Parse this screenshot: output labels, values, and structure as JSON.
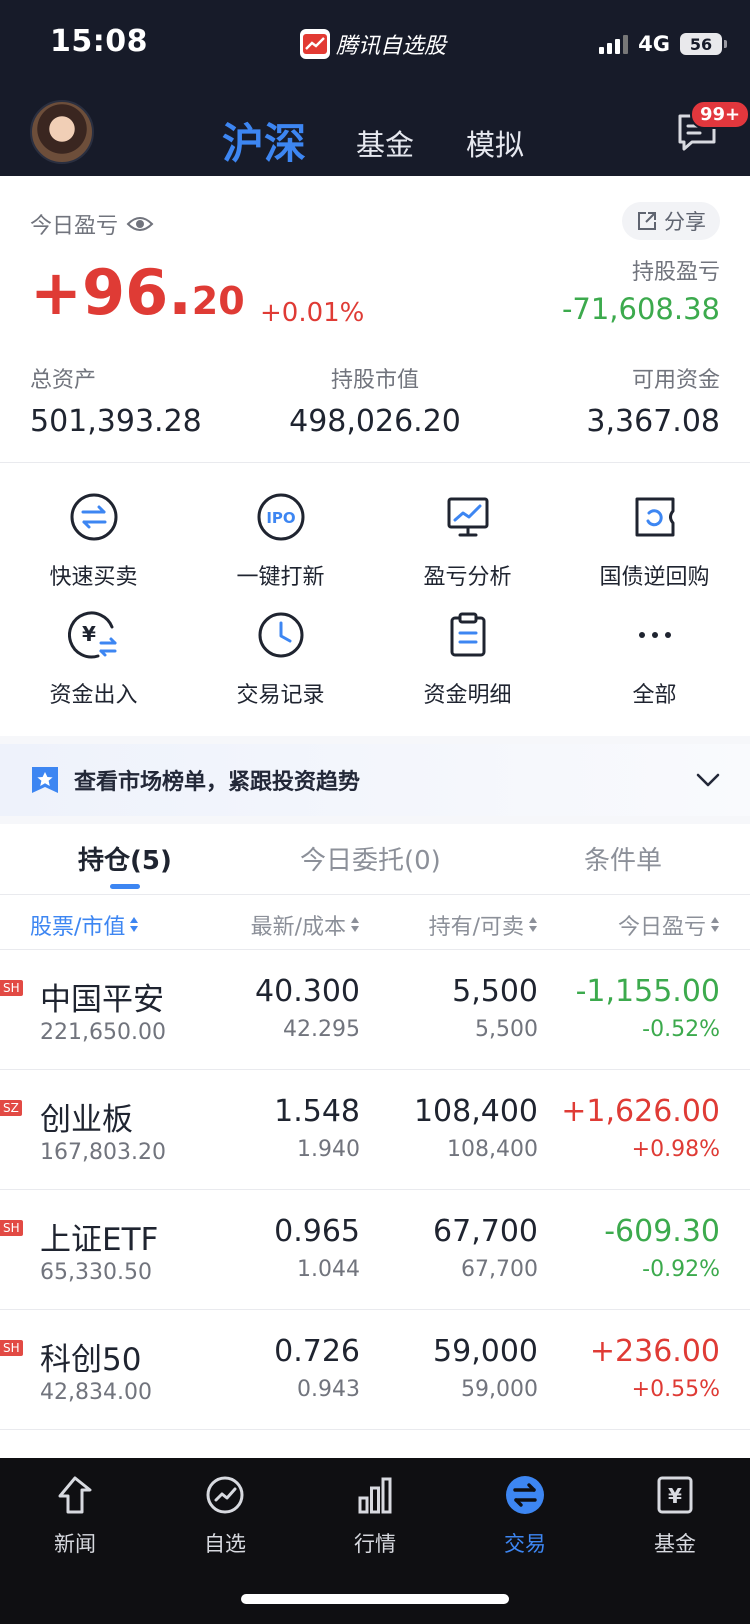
{
  "status_bar": {
    "time": "15:08",
    "app_name": "腾讯自选股",
    "network": "4G",
    "battery": "56"
  },
  "header": {
    "tabs": [
      {
        "label": "沪深",
        "active": true
      },
      {
        "label": "基金",
        "active": false
      },
      {
        "label": "模拟",
        "active": false
      }
    ],
    "message_badge": "99+"
  },
  "summary": {
    "today_pnl_label": "今日盈亏",
    "share_label": "分享",
    "today_pnl_int": "+96.",
    "today_pnl_dec": "20",
    "today_pnl_pct": "+0.01%",
    "holding_pnl_label": "持股盈亏",
    "holding_pnl_value": "-71,608.38",
    "total_assets_label": "总资产",
    "total_assets_value": "501,393.28",
    "market_value_label": "持股市值",
    "market_value_value": "498,026.20",
    "available_label": "可用资金",
    "available_value": "3,367.08"
  },
  "quick_actions": [
    {
      "label": "快速买卖",
      "icon": "swap-icon"
    },
    {
      "label": "一键打新",
      "icon": "ipo-icon"
    },
    {
      "label": "盈亏分析",
      "icon": "monitor-chart-icon"
    },
    {
      "label": "国债逆回购",
      "icon": "ticket-icon"
    },
    {
      "label": "资金出入",
      "icon": "yuan-transfer-icon"
    },
    {
      "label": "交易记录",
      "icon": "clock-icon"
    },
    {
      "label": "资金明细",
      "icon": "clipboard-icon"
    },
    {
      "label": "全部",
      "icon": "more-icon"
    }
  ],
  "banner": {
    "text": "查看市场榜单，紧跟投资趋势"
  },
  "position_tabs": [
    {
      "label": "持仓(5)",
      "active": true
    },
    {
      "label": "今日委托(0)",
      "active": false
    },
    {
      "label": "条件单",
      "active": false
    }
  ],
  "table": {
    "headers": [
      "股票/市值",
      "最新/成本",
      "持有/可卖",
      "今日盈亏"
    ],
    "rows": [
      {
        "market": "SH",
        "name": "中国平安",
        "value": "221,650.00",
        "latest": "40.300",
        "cost": "42.295",
        "hold": "5,500",
        "sellable": "5,500",
        "pnl": "-1,155.00",
        "pnl_pct": "-0.52%",
        "trend": "down"
      },
      {
        "market": "SZ",
        "name": "创业板",
        "value": "167,803.20",
        "latest": "1.548",
        "cost": "1.940",
        "hold": "108,400",
        "sellable": "108,400",
        "pnl": "+1,626.00",
        "pnl_pct": "+0.98%",
        "trend": "up"
      },
      {
        "market": "SH",
        "name": "上证ETF",
        "value": "65,330.50",
        "latest": "0.965",
        "cost": "1.044",
        "hold": "67,700",
        "sellable": "67,700",
        "pnl": "-609.30",
        "pnl_pct": "-0.92%",
        "trend": "down"
      },
      {
        "market": "SH",
        "name": "科创50",
        "value": "42,834.00",
        "latest": "0.726",
        "cost": "0.943",
        "hold": "59,000",
        "sellable": "59,000",
        "pnl": "+236.00",
        "pnl_pct": "+0.55%",
        "trend": "up"
      }
    ]
  },
  "bottom_nav": [
    {
      "label": "新闻",
      "icon": "news-icon",
      "active": false
    },
    {
      "label": "自选",
      "icon": "watchlist-icon",
      "active": false
    },
    {
      "label": "行情",
      "icon": "market-icon",
      "active": false
    },
    {
      "label": "交易",
      "icon": "trade-icon",
      "active": true
    },
    {
      "label": "基金",
      "icon": "fund-icon",
      "active": false
    }
  ],
  "colors": {
    "accent": "#3d86f2",
    "up": "#df3b35",
    "down": "#3caa4d",
    "header_bg": "#171b29"
  }
}
